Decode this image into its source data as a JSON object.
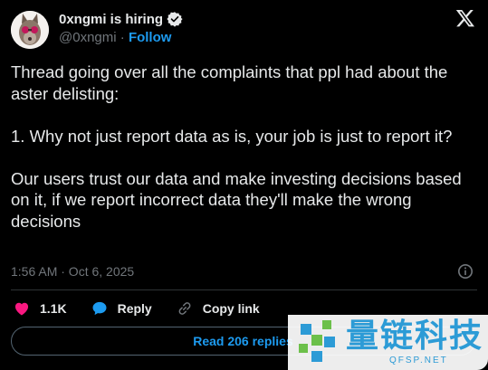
{
  "author": {
    "display_name": "0xngmi is hiring",
    "handle": "@0xngmi",
    "separator": "·",
    "follow_label": "Follow"
  },
  "tweet": {
    "text": "Thread going over all the complaints that ppl had about the aster delisting:\n\n1. Why not just report data as is, your job is just to report it?\n\nOur users trust our data and make investing decisions based on it, if we report incorrect data they'll make the wrong decisions",
    "timestamp": "1:56 AM · Oct 6, 2025"
  },
  "actions": {
    "likes_count": "1.1K",
    "reply_label": "Reply",
    "copy_link_label": "Copy link"
  },
  "read_replies_label": "Read 206 replies",
  "watermark": {
    "title": "量链科技",
    "subtitle": "QFSP.NET"
  },
  "colors": {
    "background": "#000000",
    "text": "#e7e9ea",
    "muted": "#71767b",
    "accent": "#1d9bf0",
    "like": "#f91880",
    "watermark": "#2c9bd6"
  },
  "icons": [
    "verified-badge-icon",
    "x-logo-icon",
    "info-icon",
    "heart-icon",
    "reply-bubble-icon",
    "link-icon",
    "watermark-logo-icon"
  ]
}
